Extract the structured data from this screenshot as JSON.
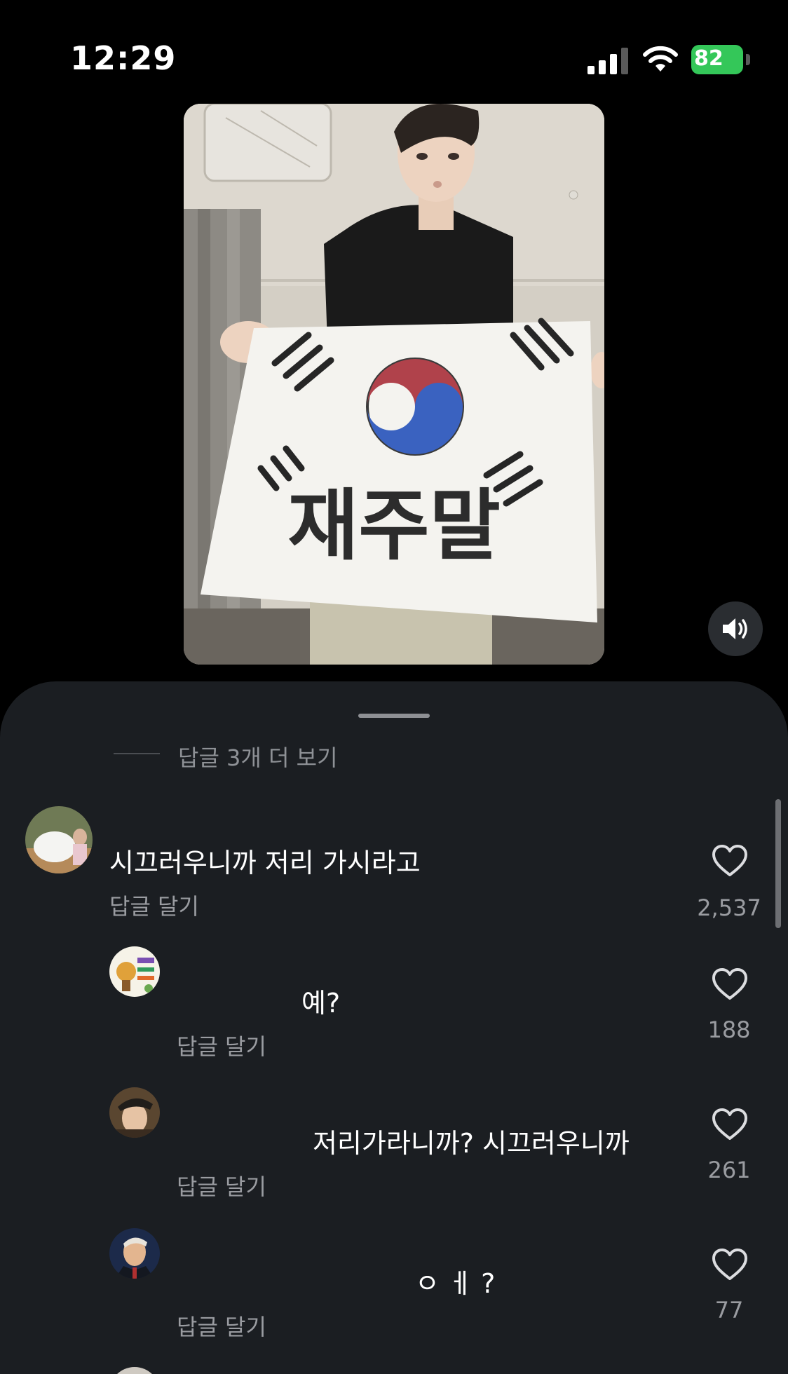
{
  "status_bar": {
    "time": "12:29",
    "battery": "82"
  },
  "video": {
    "sign_text": "재주말",
    "sound_icon": "speaker-on-icon"
  },
  "comments_sheet": {
    "more_replies": "답글 3개 더 보기",
    "comments": [
      {
        "text": "시끄러우니까 저리 가시라고",
        "reply_label": "답글 달기",
        "likes": "2,537",
        "avatar": "white-dog-avatar"
      },
      {
        "text": "예?",
        "reply_label": "답글 달기",
        "likes": "188",
        "avatar": "sticker-avatar"
      },
      {
        "text": "저리가라니까? 시끄러우니까",
        "reply_label": "답글 달기",
        "likes": "261",
        "avatar": "cap-person-avatar"
      },
      {
        "text": "ㅇ ㅔ ?",
        "reply_label": "답글 달기",
        "likes": "77",
        "avatar": "suit-person-avatar"
      }
    ]
  },
  "colors": {
    "sheet_bg": "#1b1e22",
    "battery": "#34c759",
    "secondary_text": "#9a9ca1"
  }
}
